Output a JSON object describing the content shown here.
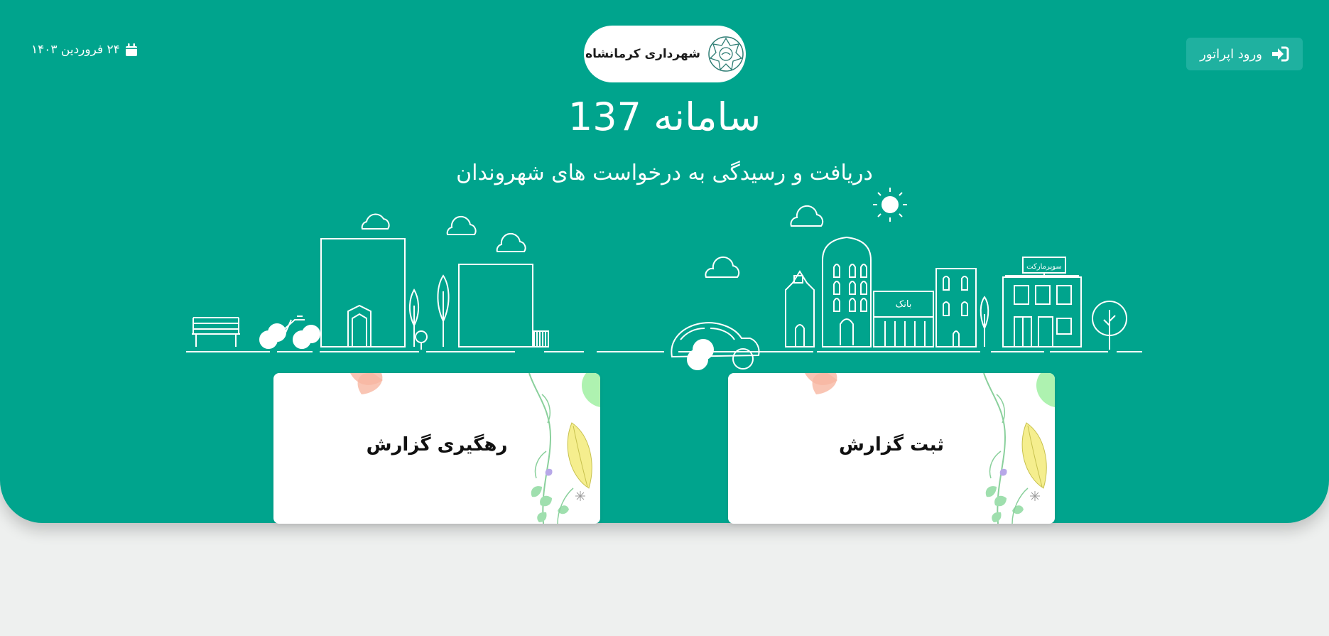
{
  "header": {
    "login_label": "ورود اپراتور",
    "org_name": "شهرداری کرمانشاه",
    "date": "۲۴ فروردین ۱۴۰۳"
  },
  "hero": {
    "title": "سامانه 137",
    "subtitle": "دریافت و رسیدگی به درخواست های شهروندان"
  },
  "skyline": {
    "bank_sign": "بانک",
    "market_sign": "سوپرمارکت"
  },
  "cards": [
    {
      "label": "رهگیری گزارش"
    },
    {
      "label": "ثبت گزارش"
    }
  ],
  "colors": {
    "primary": "#00a48d",
    "button": "#1fb1a0",
    "page_bg": "#eef0ef"
  },
  "icons": {
    "login": "sign-in-icon",
    "date": "calendar-icon",
    "logo": "municipality-emblem"
  }
}
